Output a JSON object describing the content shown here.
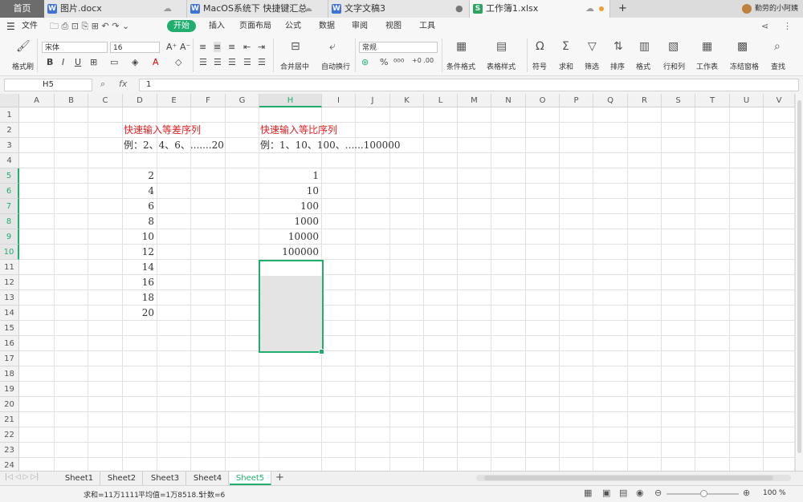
{
  "tabs": {
    "home": "首页",
    "doc1": "图片.docx",
    "doc2": "MacOS系统下 快捷键汇总",
    "doc3": "文字文稿3",
    "active": "工作簿1.xlsx",
    "add": "+",
    "user": "勤劳的小阿姨"
  },
  "menu": {
    "file": "文件",
    "items": [
      "开始",
      "插入",
      "页面布局",
      "公式",
      "数据",
      "审阅",
      "视图",
      "工具"
    ]
  },
  "ribbon": {
    "format_painter": "格式刷",
    "font_name": "宋体",
    "font_size": "16",
    "number_format": "常规",
    "merge_center": "合并居中",
    "wrap_text": "自动换行",
    "tools": [
      "条件格式",
      "表格样式",
      "符号",
      "求和",
      "筛选",
      "排序",
      "格式",
      "行和列",
      "工作表",
      "冻结窗格",
      "查找"
    ]
  },
  "formula_bar": {
    "cell_ref": "H5",
    "fx": "fx",
    "value": "1"
  },
  "columns": [
    "A",
    "B",
    "C",
    "D",
    "E",
    "F",
    "G",
    "H",
    "I",
    "J",
    "K",
    "L",
    "M",
    "N",
    "O",
    "P",
    "Q",
    "R",
    "S",
    "T",
    "U",
    "V"
  ],
  "rows": [
    "1",
    "2",
    "3",
    "4",
    "5",
    "6",
    "7",
    "8",
    "9",
    "10",
    "11",
    "12",
    "13",
    "14",
    "15",
    "16",
    "17",
    "18",
    "19",
    "20",
    "21",
    "22",
    "23",
    "24"
  ],
  "cells": {
    "D2": "快速输入等差序列",
    "D3": "例：2、4、6、.......20",
    "H2": "快速输入等比序列",
    "H3": "例：1、10、100、......100000",
    "D_series": [
      "2",
      "4",
      "6",
      "8",
      "10",
      "12",
      "14",
      "16",
      "18",
      "20"
    ],
    "H_series": [
      "1",
      "10",
      "100",
      "1000",
      "10000",
      "100000"
    ]
  },
  "sheets": [
    "Sheet1",
    "Sheet2",
    "Sheet3",
    "Sheet4",
    "Sheet5"
  ],
  "active_sheet": "Sheet5",
  "status": {
    "sum": "求和=11万1111",
    "avg": "平均值=1万8518.5",
    "count": "计数=6",
    "zoom": "100 %"
  },
  "colors": {
    "accent": "#1fae6e",
    "title_red": "#e02020"
  }
}
